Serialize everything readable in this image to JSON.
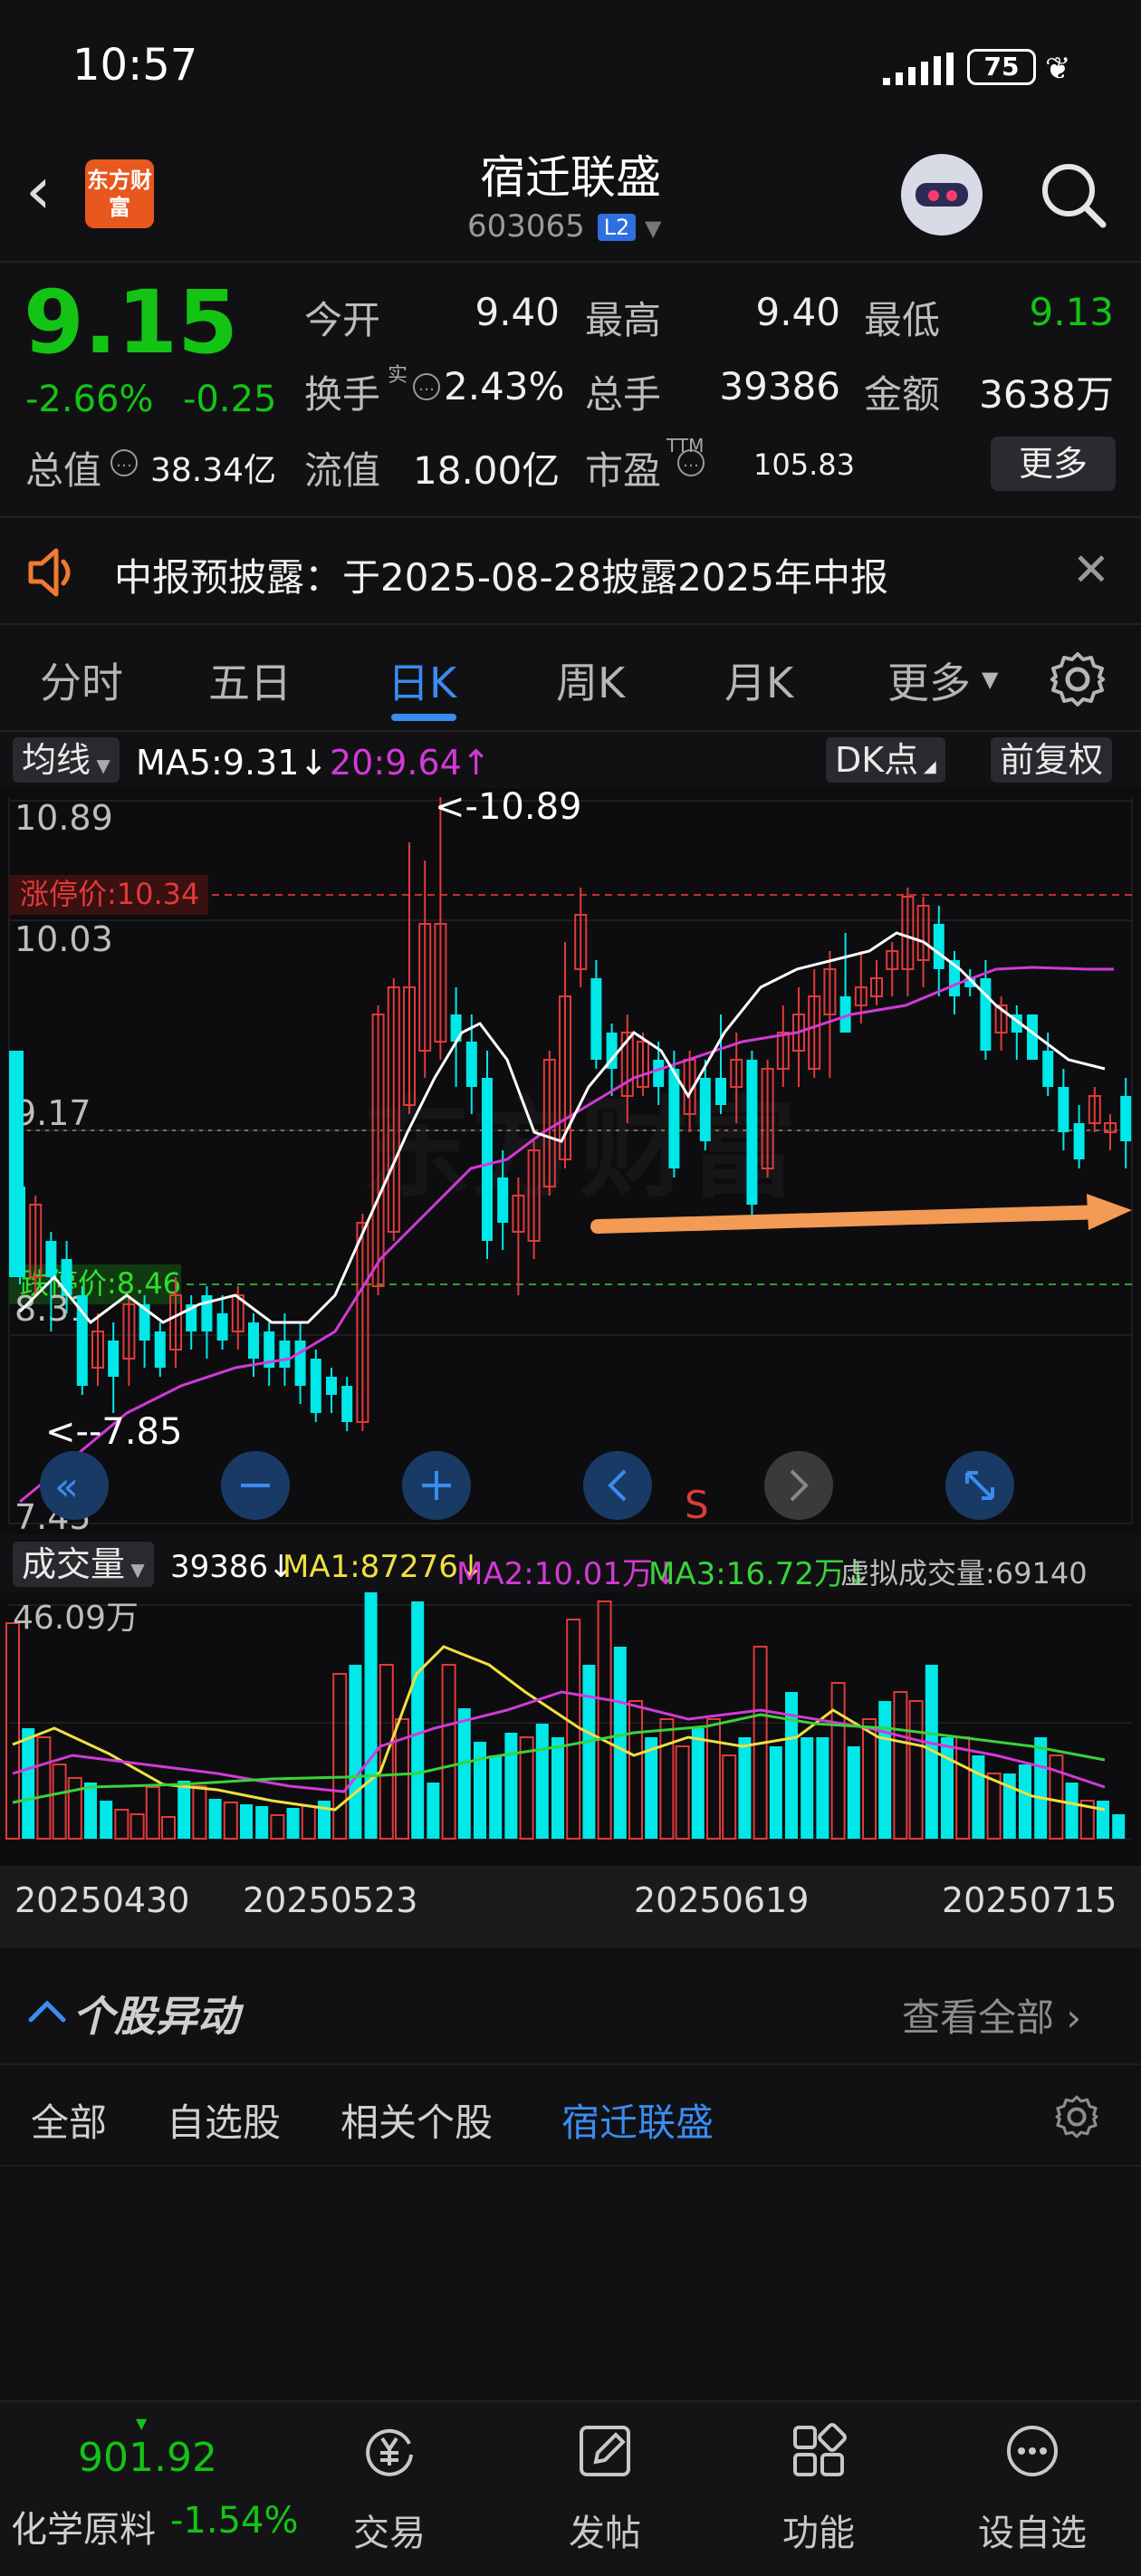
{
  "status": {
    "time": "10:57",
    "battery": "75"
  },
  "header": {
    "back_icon": "chevron-left-icon",
    "logo_text": "东方财富",
    "stock_name": "宿迁联盛",
    "code": "603065",
    "level_badge": "L2"
  },
  "quote": {
    "price": "9.15",
    "change_pct": "-2.66%",
    "change_abs": "-0.25",
    "fields": {
      "open_label": "今开",
      "open": "9.40",
      "high_label": "最高",
      "high": "9.40",
      "low_label": "最低",
      "low": "9.13",
      "turnover_label": "换手",
      "turnover_sup": "实",
      "turnover": "2.43%",
      "volume_label": "总手",
      "volume": "39386",
      "amount_label": "金额",
      "amount": "3638万",
      "mktcap_label": "总值",
      "mktcap": "38.34亿",
      "float_label": "流值",
      "float_cap": "18.00亿",
      "pe_label": "市盈",
      "pe_sup": "TTM",
      "pe": "105.83"
    },
    "more_label": "更多"
  },
  "notice": {
    "text": "中报预披露：于2025-08-28披露2025年中报"
  },
  "tabs": [
    {
      "label": "分时"
    },
    {
      "label": "五日"
    },
    {
      "label": "日K"
    },
    {
      "label": "周K"
    },
    {
      "label": "月K"
    },
    {
      "label": "更多"
    }
  ],
  "active_tab": "日K",
  "ma_bar": {
    "selector": "均线",
    "ma5": "MA5:9.31",
    "ma20": "20:9.64",
    "dk_label": "DK点",
    "adjust_label": "前复权"
  },
  "kchart": {
    "y_labels": [
      "10.89",
      "10.03",
      "9.17",
      "8.31",
      "7.45"
    ],
    "limit_up": "涨停价:10.34",
    "limit_down": "跌停价:8.46",
    "max_mark": "<-10.89",
    "min_mark": "<--7.85",
    "s_marker": "S"
  },
  "volbar": {
    "selector": "成交量",
    "vol": "39386",
    "ma1": "MA1:87276",
    "ma2": "MA2:10.01万",
    "ma3": "MA3:16.72万",
    "virtual": "虚拟成交量:69140",
    "max_label": "46.09万"
  },
  "dates": [
    "20250430",
    "20250523",
    "20250619",
    "20250715"
  ],
  "colors": {
    "up": "#e03a3a",
    "down": "#00e8e8",
    "price_down": "#14c414",
    "accent": "#3a8cf0",
    "ma5": "#ffffff",
    "ma20": "#d23ad6",
    "arrow": "#f39a55"
  },
  "movement": {
    "title": "个股异动",
    "view_all": "查看全部"
  },
  "subtabs": [
    {
      "label": "全部"
    },
    {
      "label": "自选股"
    },
    {
      "label": "相关个股"
    },
    {
      "label": "宿迁联盛"
    }
  ],
  "bottom_nav": {
    "index_value": "901.92",
    "index_name": "化学原料",
    "index_change": "-1.54%",
    "items": [
      {
        "label": "交易"
      },
      {
        "label": "发帖"
      },
      {
        "label": "功能"
      },
      {
        "label": "设自选"
      }
    ]
  }
}
